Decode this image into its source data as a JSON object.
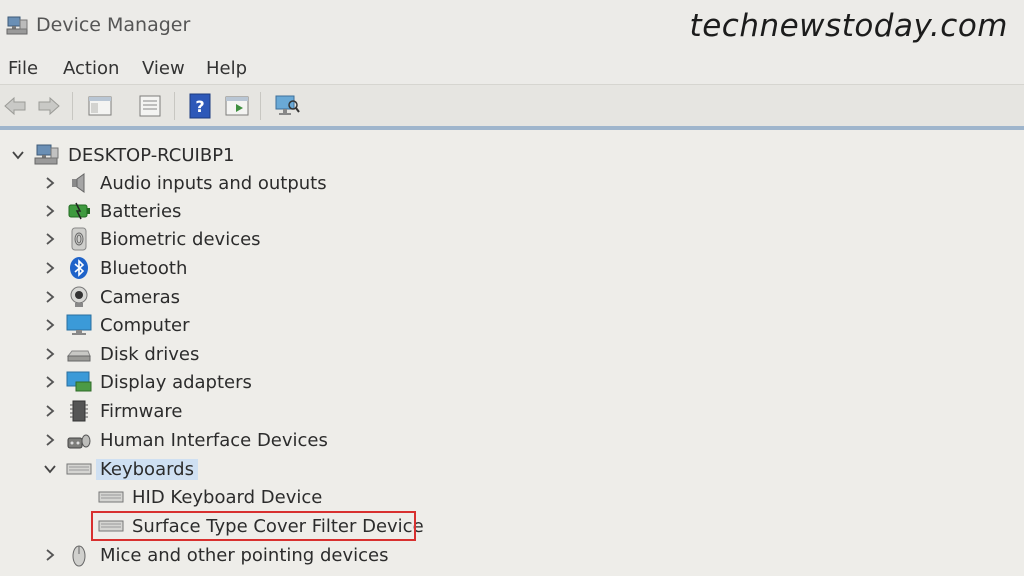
{
  "window": {
    "title": "Device Manager",
    "watermark": "technewstoday.com"
  },
  "menu": [
    {
      "label": "File"
    },
    {
      "label": "Action"
    },
    {
      "label": "View"
    },
    {
      "label": "Help"
    }
  ],
  "toolbar": [
    {
      "icon": "back-arrow-icon"
    },
    {
      "icon": "forward-arrow-icon"
    },
    {
      "icon": "show-hide-console-tree-icon"
    },
    {
      "icon": "properties-icon"
    },
    {
      "icon": "help-icon"
    },
    {
      "icon": "run-action-icon"
    },
    {
      "icon": "scan-hardware-icon"
    }
  ],
  "tree": {
    "root": {
      "label": "DESKTOP-RCUIBP1",
      "expanded": true
    },
    "categories": [
      {
        "label": "Audio inputs and outputs",
        "icon": "speaker-icon",
        "expanded": false
      },
      {
        "label": "Batteries",
        "icon": "battery-icon",
        "expanded": false
      },
      {
        "label": "Biometric devices",
        "icon": "fingerprint-icon",
        "expanded": false
      },
      {
        "label": "Bluetooth",
        "icon": "bluetooth-icon",
        "expanded": false
      },
      {
        "label": "Cameras",
        "icon": "webcam-icon",
        "expanded": false
      },
      {
        "label": "Computer",
        "icon": "monitor-icon",
        "expanded": false
      },
      {
        "label": "Disk drives",
        "icon": "disk-drive-icon",
        "expanded": false
      },
      {
        "label": "Display adapters",
        "icon": "display-adapter-icon",
        "expanded": false
      },
      {
        "label": "Firmware",
        "icon": "firmware-chip-icon",
        "expanded": false
      },
      {
        "label": "Human Interface Devices",
        "icon": "hid-icon",
        "expanded": false
      },
      {
        "label": "Keyboards",
        "icon": "keyboard-icon",
        "expanded": true,
        "selected": true,
        "children": [
          {
            "label": "HID Keyboard Device",
            "icon": "keyboard-icon"
          },
          {
            "label": "Surface Type Cover Filter Device",
            "icon": "keyboard-icon",
            "highlighted": true
          }
        ]
      },
      {
        "label": "Mice and other pointing devices",
        "icon": "mouse-icon",
        "expanded": false
      }
    ]
  },
  "colors": {
    "selection": "#cfe0f2",
    "highlight_box": "#d8302f",
    "divider": "#9fb5cc"
  }
}
